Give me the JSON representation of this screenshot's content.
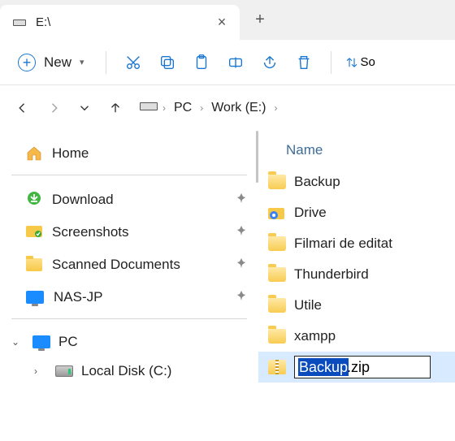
{
  "tab": {
    "title": "E:\\",
    "icon": "drive-icon"
  },
  "toolbar": {
    "new_label": "New",
    "sort_label": "So"
  },
  "breadcrumb": {
    "seg1": "PC",
    "seg2": "Work (E:)"
  },
  "sidebar": {
    "home": "Home",
    "quick": [
      {
        "label": "Download",
        "icon": "download-folder"
      },
      {
        "label": "Screenshots",
        "icon": "screenshots-folder"
      },
      {
        "label": "Scanned Documents",
        "icon": "folder"
      },
      {
        "label": "NAS-JP",
        "icon": "monitor"
      }
    ],
    "pc": {
      "label": "PC",
      "child": "Local Disk (C:)"
    }
  },
  "content": {
    "header": "Name",
    "items": [
      {
        "label": "Backup",
        "type": "folder"
      },
      {
        "label": "Drive",
        "type": "drive-shortcut"
      },
      {
        "label": "Filmari de editat",
        "type": "folder"
      },
      {
        "label": "Thunderbird",
        "type": "folder"
      },
      {
        "label": "Utile",
        "type": "folder"
      },
      {
        "label": "xampp",
        "type": "folder"
      }
    ],
    "rename": {
      "full": "Backup.zip",
      "selected": "Backup"
    }
  }
}
